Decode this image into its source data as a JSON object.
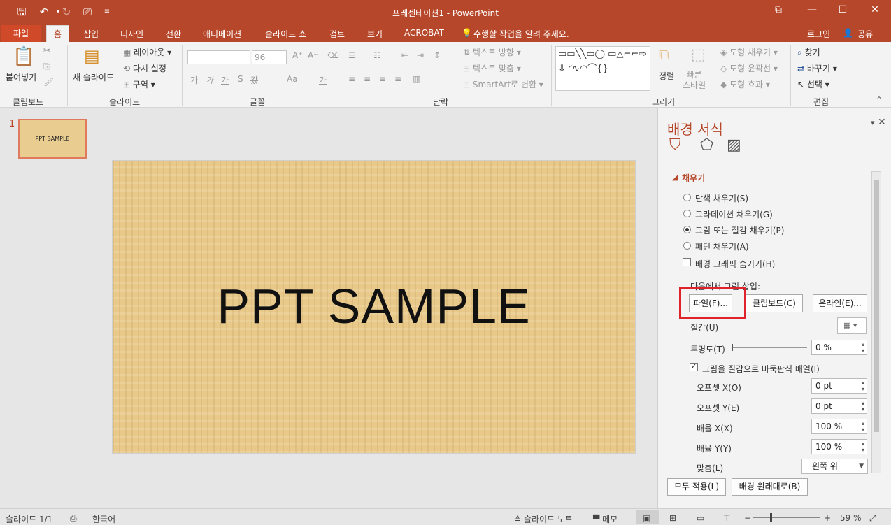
{
  "titlebar": {
    "title": "프레젠테이션1 - PowerPoint",
    "save_icon": "save-icon",
    "undo_icon": "undo-icon",
    "redo_icon": "redo-icon",
    "present_icon": "present-icon",
    "customize_icon": "customize-qat-icon",
    "ribbon_opts": "ribbon-display-options-icon"
  },
  "tabs": {
    "file": "파일",
    "home": "홈",
    "insert": "삽입",
    "design": "디자인",
    "transitions": "전환",
    "animations": "애니메이션",
    "slideshow": "슬라이드 쇼",
    "review": "검토",
    "view": "보기",
    "acrobat": "ACROBAT",
    "tellme": "수행할 작업을 알려 주세요.",
    "login": "로그인",
    "share": "공유"
  },
  "ribbon": {
    "paste": "붙여넣기",
    "clipboard": "클립보드",
    "new_slide": "새 슬라이드",
    "layout": "레이아웃",
    "reset": "다시 설정",
    "section": "구역",
    "slides": "슬라이드",
    "font_size": "96",
    "font": "글꼴",
    "text_direction": "텍스트 방향",
    "align_text": "텍스트 맞춤",
    "smartart": "SmartArt로 변환",
    "paragraph": "단락",
    "arrange": "정렬",
    "quick_styles": "빠른\n스타일",
    "shape_fill": "도형 채우기",
    "shape_outline": "도형 윤곽선",
    "shape_effects": "도형 효과",
    "drawing": "그리기",
    "find": "찾기",
    "replace": "바꾸기",
    "select": "선택",
    "editing": "편집",
    "font_btns": [
      "가",
      "가",
      "가",
      "S",
      "갔",
      "Aa",
      "가"
    ]
  },
  "leftpane": {
    "slide_number": "1",
    "thumb_text": "PPT SAMPLE"
  },
  "slide": {
    "title": "PPT SAMPLE"
  },
  "format_pane": {
    "title": "배경 서식",
    "section": "채우기",
    "options": [
      "단색 채우기(S)",
      "그라데이션 채우기(G)",
      "그림 또는 질감 채우기(P)",
      "패턴 채우기(A)"
    ],
    "hide_bg": "배경 그래픽 숨기기(H)",
    "insert_from": "다음에서 그림 삽입:",
    "btn_file": "파일(F)...",
    "btn_clipboard": "클립보드(C)",
    "btn_online": "온라인(E)...",
    "texture": "질감(U)",
    "transparency": "투명도(T)",
    "transparency_value": "0 %",
    "tile": "그림을 질감으로 바둑판식 배열(I)",
    "offset_x": "오프셋 X(O)",
    "offset_x_value": "0 pt",
    "offset_y": "오프셋 Y(E)",
    "offset_y_value": "0 pt",
    "scale_x": "배율 X(X)",
    "scale_x_value": "100 %",
    "scale_y": "배율 Y(Y)",
    "scale_y_value": "100 %",
    "alignment": "맞춤(L)",
    "alignment_value": "왼쪽 위",
    "apply_all": "모두 적용(L)",
    "reset_bg": "배경 원래대로(B)"
  },
  "status": {
    "slide": "슬라이드 1/1",
    "language": "한국어",
    "notes": "슬라이드 노트",
    "comments": "메모",
    "zoom": "59 %"
  },
  "colors": {
    "accent": "#b7472a",
    "highlight": "#e0232a"
  }
}
